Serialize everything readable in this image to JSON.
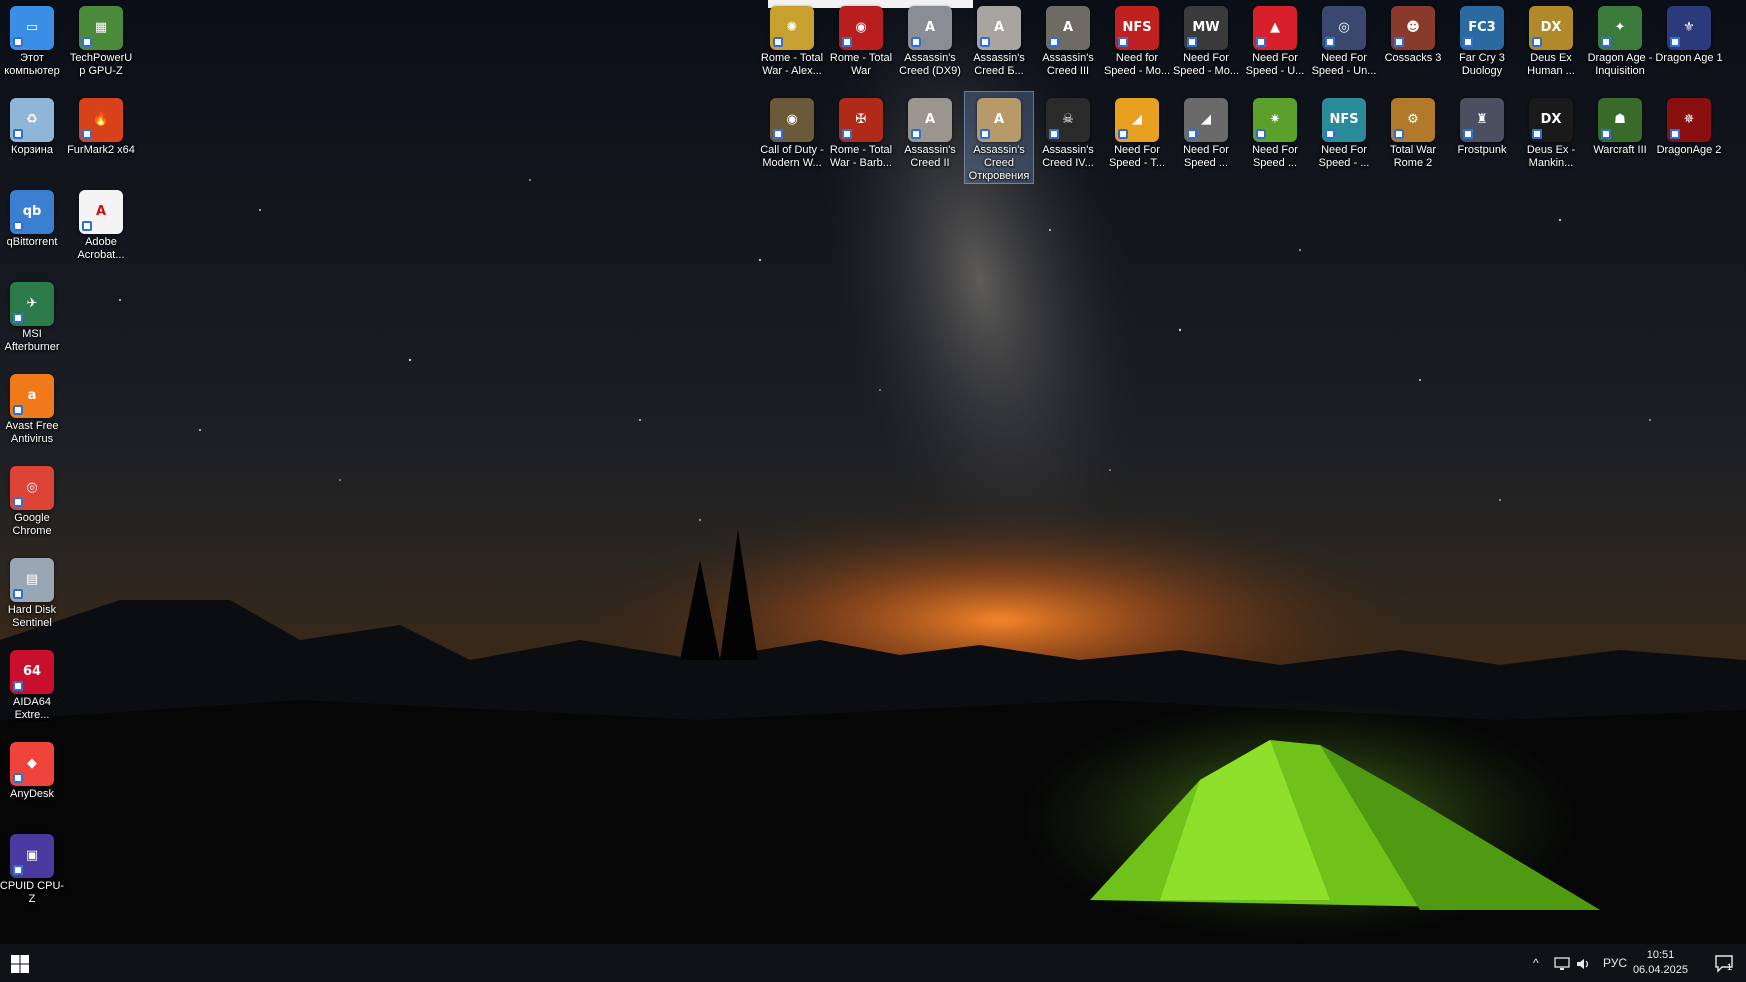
{
  "left_icons": [
    {
      "label": "Этот компьютер",
      "icon": "computer-icon",
      "color": "#3a8ee6",
      "glyph": "▭"
    },
    {
      "label": "TechPowerUp GPU-Z",
      "icon": "gpuz-icon",
      "color": "#4a8a3a",
      "glyph": "▦"
    },
    {
      "label": "Корзина",
      "icon": "recycle-bin-icon",
      "color": "#8fb6d6",
      "glyph": "♻"
    },
    {
      "label": "FurMark2 x64",
      "icon": "furmark-icon",
      "color": "#d8421a",
      "glyph": "🔥"
    },
    {
      "label": "qBittorrent",
      "icon": "qbittorrent-icon",
      "color": "#3a7fd0",
      "glyph": "qb"
    },
    {
      "label": "Adobe Acrobat...",
      "icon": "acrobat-icon",
      "color": "#f4f4f4",
      "glyph": "A"
    },
    {
      "label": "MSI Afterburner",
      "icon": "afterburner-icon",
      "color": "#2d7a4a",
      "glyph": "✈"
    },
    {
      "label": "Avast Free Antivirus",
      "icon": "avast-icon",
      "color": "#f07a1a",
      "glyph": "a"
    },
    {
      "label": "Google Chrome",
      "icon": "chrome-icon",
      "color": "#db4437",
      "glyph": "◎"
    },
    {
      "label": "Hard Disk Sentinel",
      "icon": "hdsentinel-icon",
      "color": "#9aa6b4",
      "glyph": "▤"
    },
    {
      "label": "AIDA64 Extre...",
      "icon": "aida64-icon",
      "color": "#c8102e",
      "glyph": "64"
    },
    {
      "label": "AnyDesk",
      "icon": "anydesk-icon",
      "color": "#ef443b",
      "glyph": "◆"
    },
    {
      "label": "CPUID CPU-Z",
      "icon": "cpuz-icon",
      "color": "#4a3aa0",
      "glyph": "▣"
    }
  ],
  "game_row1": [
    {
      "label": "Rome - Total War - Alex...",
      "icon": "rome-alexander-icon",
      "color": "#c8a030",
      "glyph": "✺"
    },
    {
      "label": "Rome - Total War",
      "icon": "rome-total-war-icon",
      "color": "#b81e1e",
      "glyph": "◉"
    },
    {
      "label": "Assassin's Creed (DX9)",
      "icon": "assassins-creed-dx9-icon",
      "color": "#8a8e94",
      "glyph": "A"
    },
    {
      "label": "Assassin's Creed Б...",
      "icon": "assassins-creed-brotherhood-icon",
      "color": "#a8a4a0",
      "glyph": "A"
    },
    {
      "label": "Assassin's Creed III",
      "icon": "assassins-creed-3-icon",
      "color": "#6e6a64",
      "glyph": "A"
    },
    {
      "label": "Need for Speed - Mo...",
      "icon": "nfs-most-wanted-1-icon",
      "color": "#c02020",
      "glyph": "NFS"
    },
    {
      "label": "Need For Speed - Mo...",
      "icon": "nfs-most-wanted-2-icon",
      "color": "#3a3a3a",
      "glyph": "MW"
    },
    {
      "label": "Need For Speed - U...",
      "icon": "nfs-underground-icon",
      "color": "#d8202a",
      "glyph": "▲"
    },
    {
      "label": "Need For Speed - Un...",
      "icon": "nfs-underground-2-icon",
      "color": "#3a4870",
      "glyph": "◎"
    },
    {
      "label": "Cossacks 3",
      "icon": "cossacks-3-icon",
      "color": "#8a3a2a",
      "glyph": "☻"
    },
    {
      "label": "Far Cry 3 Duology",
      "icon": "far-cry-3-icon",
      "color": "#2a6aa0",
      "glyph": "FC3"
    },
    {
      "label": "Deus Ex Human ...",
      "icon": "deus-ex-hr-icon",
      "color": "#b08a2a",
      "glyph": "DX"
    },
    {
      "label": "Dragon Age - Inquisition",
      "icon": "dragon-age-inquisition-icon",
      "color": "#3a7a3a",
      "glyph": "✦"
    },
    {
      "label": "Dragon Age 1",
      "icon": "dragon-age-1-icon",
      "color": "#2a3a7a",
      "glyph": "⚜"
    }
  ],
  "game_row2": [
    {
      "label": "Call of Duty - Modern W...",
      "icon": "cod-modern-warfare-icon",
      "color": "#6a5a3a",
      "glyph": "◉"
    },
    {
      "label": "Rome - Total War - Barb...",
      "icon": "rome-barbarian-icon",
      "color": "#b02a1a",
      "glyph": "✠"
    },
    {
      "label": "Assassin's Creed II",
      "icon": "assassins-creed-2-icon",
      "color": "#9a968e",
      "glyph": "A"
    },
    {
      "label": "Assassin's Creed Откровения",
      "icon": "assassins-creed-revelations-icon",
      "color": "#b89a6a",
      "glyph": "A"
    },
    {
      "label": "Assassin's Creed IV...",
      "icon": "assassins-creed-4-icon",
      "color": "#2a2a2a",
      "glyph": "☠"
    },
    {
      "label": "Need For Speed - T...",
      "icon": "nfs-shift-icon",
      "color": "#e8a020",
      "glyph": "◢"
    },
    {
      "label": "Need For Speed ...",
      "icon": "nfs-shift-2-icon",
      "color": "#6a6a6a",
      "glyph": "◢"
    },
    {
      "label": "Need For Speed ...",
      "icon": "nfs-hot-pursuit-icon",
      "color": "#5aa02a",
      "glyph": "✷"
    },
    {
      "label": "Need For Speed - ...",
      "icon": "nfs-carbon-icon",
      "color": "#2a8a9a",
      "glyph": "NFS"
    },
    {
      "label": "Total War Rome 2",
      "icon": "total-war-rome-2-icon",
      "color": "#b07a2a",
      "glyph": "⚙"
    },
    {
      "label": "Frostpunk",
      "icon": "frostpunk-icon",
      "color": "#4a5060",
      "glyph": "♜"
    },
    {
      "label": "Deus Ex - Mankin...",
      "icon": "deus-ex-md-icon",
      "color": "#1a1a1a",
      "glyph": "DX"
    },
    {
      "label": "Warcraft III",
      "icon": "warcraft-3-icon",
      "color": "#3a6a2a",
      "glyph": "☗"
    },
    {
      "label": "DragonAge 2",
      "icon": "dragon-age-2-icon",
      "color": "#8a1010",
      "glyph": "✵"
    }
  ],
  "taskbar": {
    "language": "РУС",
    "time": "10:51",
    "date": "06.04.2025",
    "notification_count": "1"
  }
}
